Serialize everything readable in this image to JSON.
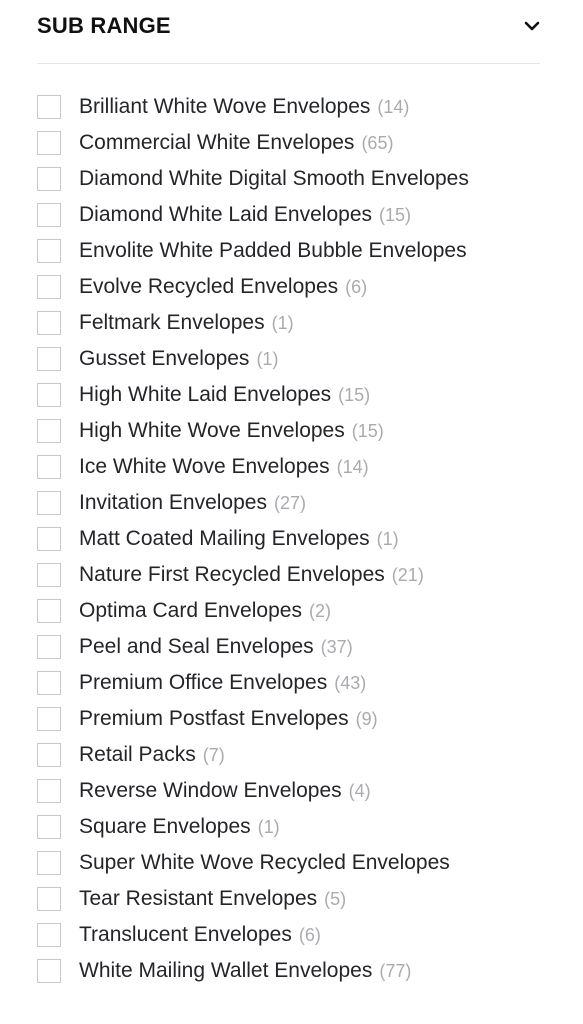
{
  "panel": {
    "title": "SUB RANGE",
    "toggle_icon": "chevron-down-icon",
    "expanded": true,
    "colors": {
      "background": "#ffffff",
      "title": "#111111",
      "label": "#232529",
      "count": "#a9abae",
      "checkbox_border": "#c9c9c9",
      "divider": "#e4e5e7"
    }
  },
  "items": [
    {
      "label": "Brilliant White Wove Envelopes",
      "count": "(14)",
      "checked": false,
      "truncated": false
    },
    {
      "label": "Commercial White Envelopes",
      "count": "(65)",
      "checked": false,
      "truncated": false
    },
    {
      "label": "Diamond White Digital Smooth Envelopes",
      "count": "",
      "checked": false,
      "truncated": true
    },
    {
      "label": "Diamond White Laid Envelopes",
      "count": "(15)",
      "checked": false,
      "truncated": false
    },
    {
      "label": "Envolite White Padded Bubble Envelopes",
      "count": "",
      "checked": false,
      "truncated": true
    },
    {
      "label": "Evolve Recycled Envelopes",
      "count": "(6)",
      "checked": false,
      "truncated": false
    },
    {
      "label": "Feltmark Envelopes",
      "count": "(1)",
      "checked": false,
      "truncated": false
    },
    {
      "label": "Gusset Envelopes",
      "count": "(1)",
      "checked": false,
      "truncated": false
    },
    {
      "label": "High White Laid Envelopes",
      "count": "(15)",
      "checked": false,
      "truncated": false
    },
    {
      "label": "High White Wove Envelopes",
      "count": "(15)",
      "checked": false,
      "truncated": false
    },
    {
      "label": "Ice White Wove Envelopes",
      "count": "(14)",
      "checked": false,
      "truncated": false
    },
    {
      "label": "Invitation Envelopes",
      "count": "(27)",
      "checked": false,
      "truncated": false
    },
    {
      "label": "Matt Coated Mailing Envelopes",
      "count": "(1)",
      "checked": false,
      "truncated": false
    },
    {
      "label": "Nature First Recycled Envelopes",
      "count": "(21)",
      "checked": false,
      "truncated": false
    },
    {
      "label": "Optima Card Envelopes",
      "count": "(2)",
      "checked": false,
      "truncated": false
    },
    {
      "label": "Peel and Seal Envelopes",
      "count": "(37)",
      "checked": false,
      "truncated": false
    },
    {
      "label": "Premium Office Envelopes",
      "count": "(43)",
      "checked": false,
      "truncated": false
    },
    {
      "label": "Premium Postfast Envelopes",
      "count": "(9)",
      "checked": false,
      "truncated": false
    },
    {
      "label": "Retail Packs",
      "count": "(7)",
      "checked": false,
      "truncated": false
    },
    {
      "label": "Reverse Window Envelopes",
      "count": "(4)",
      "checked": false,
      "truncated": false
    },
    {
      "label": "Square Envelopes",
      "count": "(1)",
      "checked": false,
      "truncated": false
    },
    {
      "label": "Super White Wove Recycled Envelopes",
      "count": "",
      "checked": false,
      "truncated": true
    },
    {
      "label": "Tear Resistant Envelopes",
      "count": "(5)",
      "checked": false,
      "truncated": false
    },
    {
      "label": "Translucent Envelopes",
      "count": "(6)",
      "checked": false,
      "truncated": false
    },
    {
      "label": "White Mailing Wallet Envelopes",
      "count": "(77)",
      "checked": false,
      "truncated": false
    }
  ]
}
